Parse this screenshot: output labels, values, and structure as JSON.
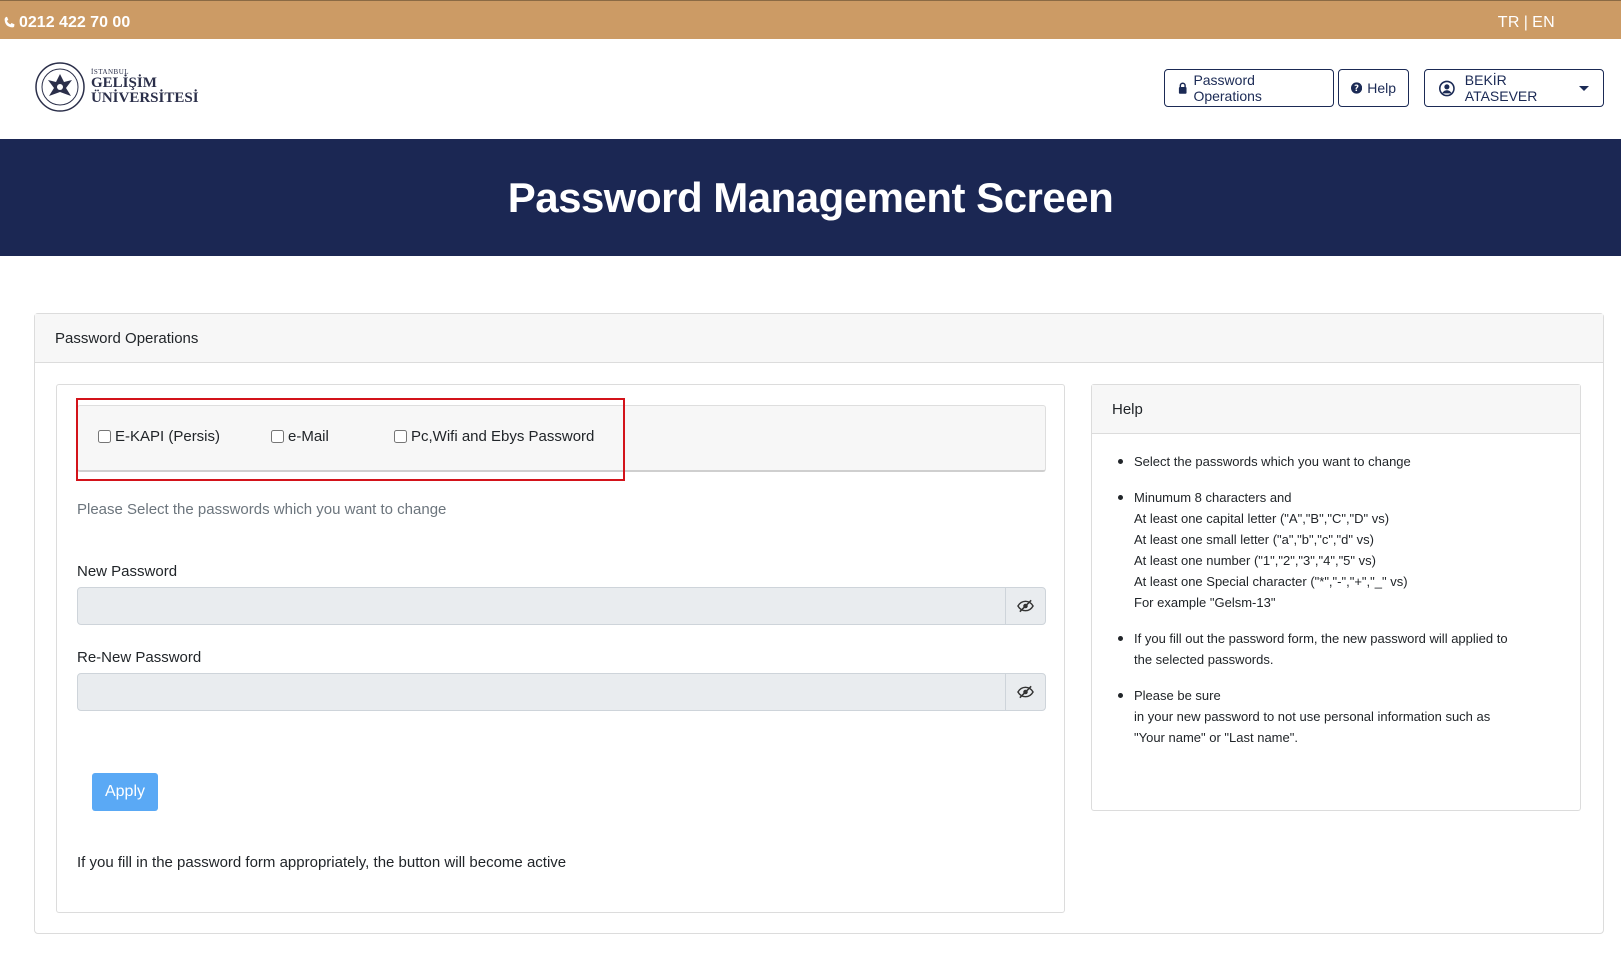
{
  "topbar": {
    "phone": "0212 422 70 00",
    "lang_tr": "TR",
    "lang_sep": "|",
    "lang_en": "EN"
  },
  "header": {
    "logo_line1": "İSTANBUL",
    "logo_line2": "GELİŞİM",
    "logo_line3": "ÜNİVERSİTESİ",
    "password_operations_label": "Password Operations",
    "help_label": "Help",
    "user_name": "BEKİR ATASEVER"
  },
  "banner": {
    "title": "Password Management Screen"
  },
  "main": {
    "card_title": "Password Operations",
    "checkboxes": [
      {
        "label": "E-KAPI (Persis)",
        "checked": false
      },
      {
        "label": "e-Mail",
        "checked": false
      },
      {
        "label": "Pc,Wifi and Ebys Password",
        "checked": false
      }
    ],
    "hint": "Please Select the passwords which you want to change",
    "new_password_label": "New Password",
    "new_password_value": "",
    "renew_password_label": "Re-New Password",
    "renew_password_value": "",
    "apply_label": "Apply",
    "footer_note": "If you fill in the password form appropriately, the button will become active"
  },
  "help": {
    "title": "Help",
    "items": [
      {
        "lines": [
          "Select the passwords which you want to change"
        ]
      },
      {
        "lines": [
          "Minumum 8 characters and",
          "At least one capital letter (\"A\",\"B\",\"C\",\"D\" vs)",
          "At least one small letter (\"a\",\"b\",\"c\",\"d\" vs)",
          "At least one number (\"1\",\"2\",\"3\",\"4\",\"5\" vs)",
          "At least one Special character (\"*\",\"-\",\"+\",\"_\" vs)",
          "For example \"Gelsm-13\""
        ]
      },
      {
        "lines": [
          "If you fill out the password form, the new password will applied to",
          "the selected passwords."
        ]
      },
      {
        "lines": [
          "Please be sure",
          "in your new password to not use personal information such as",
          "\"Your name\" or \"Last name\"."
        ]
      }
    ]
  },
  "colors": {
    "topbar": "#cc9b65",
    "banner": "#1b2753",
    "apply_button": "#5aa9f5",
    "highlight_border": "#d3131a"
  }
}
